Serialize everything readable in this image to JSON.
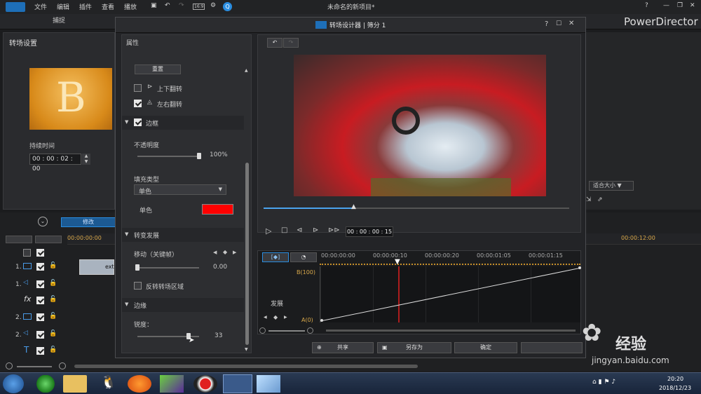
{
  "menu": {
    "file": "文件",
    "edit": "编辑",
    "plugins": "插件",
    "view": "查看",
    "playback": "播放",
    "window_title": "未命名的新项目*",
    "brand": "PowerDirector"
  },
  "tabs": {
    "capture": "捕捉"
  },
  "left_panel": {
    "title": "转场设置",
    "thumb_letter": "B",
    "duration_label": "持续时间",
    "duration_value": "00 : 00 : 02 : 00"
  },
  "dialog": {
    "title": "转场设计器 | 筛分 1",
    "help": "?",
    "props": {
      "header": "属性",
      "reset": "重置",
      "flip_v": "上下翻转",
      "flip_h": "左右翻转",
      "border": "边框",
      "opacity": "不透明度",
      "opacity_value": "100%",
      "fill_type": "填充类型",
      "fill_select": "单色",
      "color_label": "单色",
      "progression": "转变发展",
      "move": "移动（关键帧）",
      "move_value": "0.00",
      "reverse": "反转转场区域",
      "edge": "边缘",
      "sharpness": "锐度：",
      "sharpness_value": "33"
    },
    "timecode": "00 : 00 : 00 : 15",
    "keyframe": {
      "ruler": [
        "00:00:00:00",
        "00:00:00:10",
        "00:00:00:20",
        "00:00:01:05",
        "00:00:01:15"
      ],
      "param": "发展",
      "top": "B(100)",
      "bottom": "A(0)"
    },
    "buttons": {
      "share": "共享",
      "save_as": "另存为",
      "ok": "确定"
    }
  },
  "right": {
    "fit": "适合大小"
  },
  "timeline": {
    "modify": "修改",
    "ruler_left": "00:00:00:00",
    "ruler_right": "00:00:12:00",
    "clip": "ext",
    "tracks": [
      "1.",
      "1.",
      "",
      "2.",
      "2.",
      ""
    ]
  },
  "taskbar": {
    "time": "20:20",
    "date": "2018/12/23"
  },
  "watermark": {
    "text": "经验",
    "url": "jingyan.baidu.com"
  },
  "colors": {
    "accent": "#2a8de0",
    "fill_color": "#ff0000",
    "keyframe_line": "#e02020"
  }
}
